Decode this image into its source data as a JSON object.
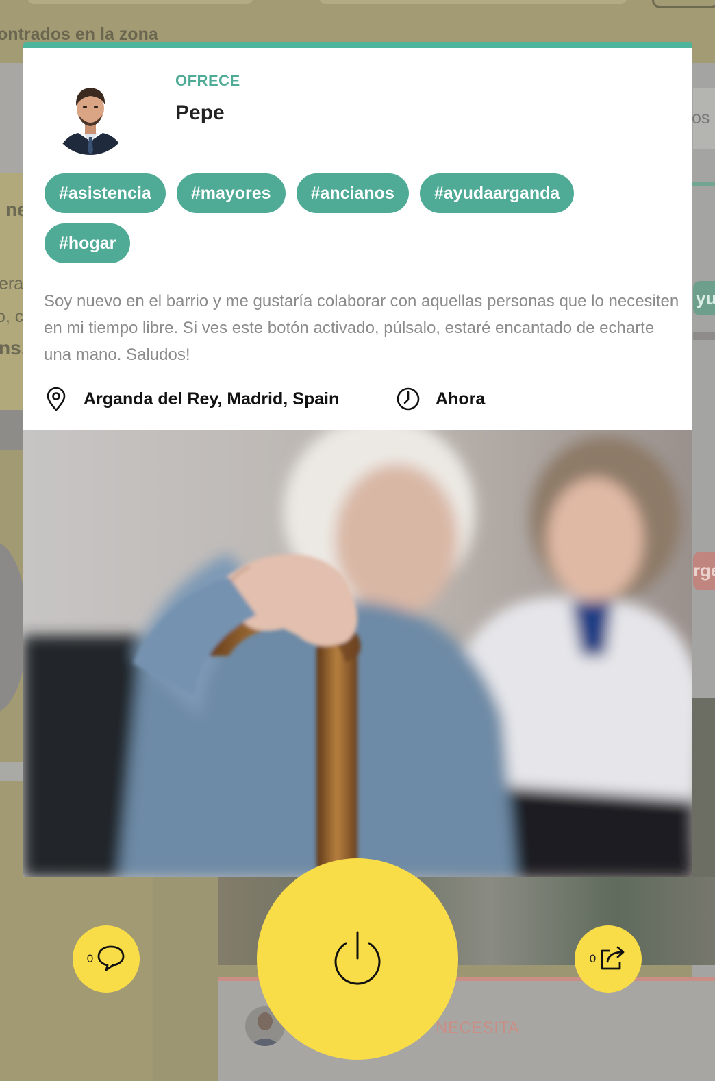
{
  "background": {
    "found_text": "ontrados en la zona",
    "left_fragments": [
      "ne",
      "era",
      "o, c",
      "ns."
    ],
    "right_fragments": [
      "os",
      "yu",
      "rge"
    ],
    "necesita_label": "NECESITA"
  },
  "card": {
    "accent_color": "#4fb49c",
    "type_label": "OFRECE",
    "user_name": "Pepe",
    "tags": [
      "#asistencia",
      "#mayores",
      "#ancianos",
      "#ayudaarganda",
      "#hogar"
    ],
    "description": "Soy nuevo en el barrio y me gustaría colaborar con aquellas personas que lo necesiten en mi tiempo libre. Si ves este botón activado, púlsalo, estaré encantado de echarte una mano. Saludos!",
    "location": "Arganda del Rey, Madrid, Spain",
    "time": "Ahora",
    "icons": {
      "location": "map-pin-icon",
      "time": "clock-icon"
    }
  },
  "actions": {
    "button_color": "#f8dc48",
    "comments_count": "0",
    "shares_count": "0",
    "icons": {
      "comment": "speech-bubble-icon",
      "power": "power-icon",
      "share": "share-icon"
    }
  }
}
